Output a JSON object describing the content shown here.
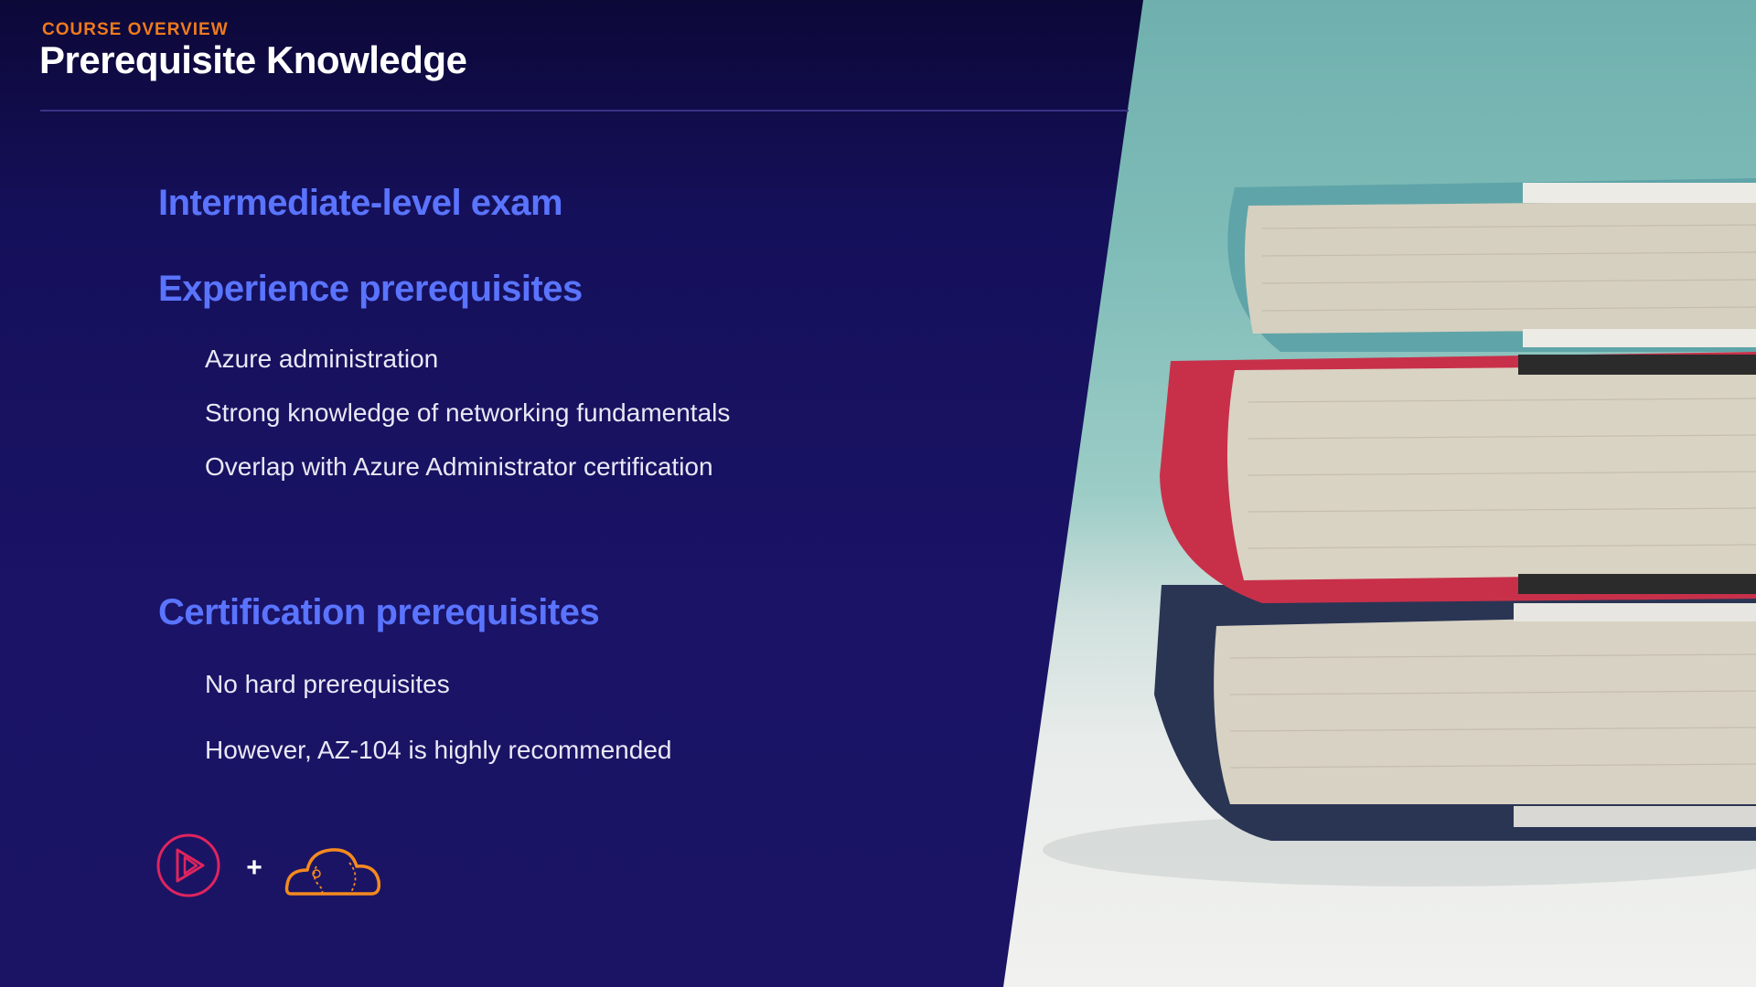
{
  "header": {
    "eyebrow": "COURSE OVERVIEW",
    "title": "Prerequisite Knowledge"
  },
  "sections": [
    {
      "heading": "Intermediate-level exam",
      "items": []
    },
    {
      "heading": "Experience prerequisites",
      "items": [
        "Azure administration",
        "Strong knowledge of networking fundamentals",
        "Overlap with Azure Administrator certification"
      ]
    },
    {
      "heading": "Certification prerequisites",
      "items": [
        "No hard prerequisites",
        "However, AZ-104 is highly recommended"
      ]
    }
  ],
  "logos": {
    "left_icon": "play-circle-icon",
    "separator": "+",
    "right_icon": "cloud-icon"
  },
  "colors": {
    "background": "#1b1464",
    "accent_orange": "#f07a1c",
    "heading_blue": "#5a74ff",
    "logo_pink": "#e0245e",
    "logo_orange": "#f58a1f"
  }
}
